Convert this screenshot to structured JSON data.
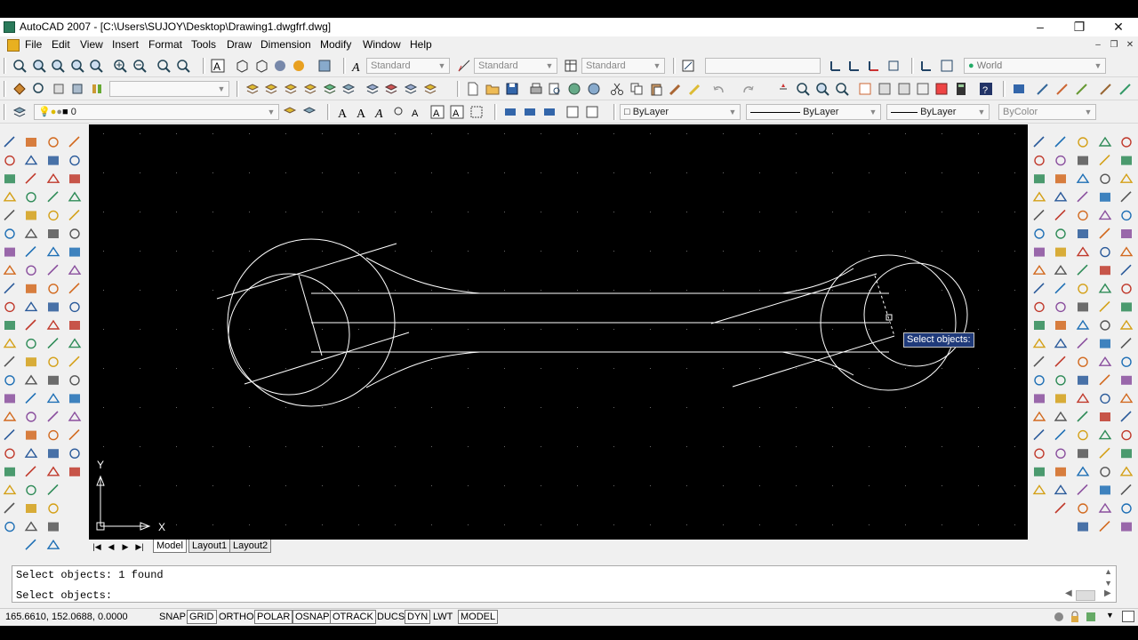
{
  "window": {
    "title": "AutoCAD 2007 - [C:\\Users\\SUJOY\\Desktop\\Drawing1.dwgfrf.dwg]",
    "minimize": "–",
    "restore": "❐",
    "close": "✕"
  },
  "menu": {
    "items": [
      "File",
      "Edit",
      "View",
      "Insert",
      "Format",
      "Tools",
      "Draw",
      "Dimension",
      "Modify",
      "Window",
      "Help"
    ]
  },
  "toolbar1": {
    "text_style": "Standard",
    "dim_style": "Standard",
    "table_style": "Standard",
    "viewport_field": "",
    "ucs": "World"
  },
  "toolbar2": {
    "workspace_field": ""
  },
  "toolbar3": {
    "layer_name": "0",
    "color": "ByLayer",
    "linetype": "ByLayer",
    "lineweight": "ByLayer",
    "plotstyle": "ByColor"
  },
  "canvas": {
    "tooltip": "Select objects:",
    "ucs_x": "X",
    "ucs_y": "Y"
  },
  "tabs": {
    "items": [
      "Model",
      "Layout1",
      "Layout2"
    ],
    "active": "Model"
  },
  "command": {
    "line1": "Select objects: 1 found",
    "line2": "Select objects:"
  },
  "status": {
    "coordinates": "165.6610, 152.0688, 0.0000",
    "buttons": [
      "SNAP",
      "GRID",
      "ORTHO",
      "POLAR",
      "OSNAP",
      "OTRACK",
      "DUCS",
      "DYN",
      "LWT",
      "MODEL"
    ],
    "active_buttons": [
      "GRID",
      "POLAR",
      "OSNAP",
      "OTRACK",
      "DYN",
      "MODEL"
    ]
  },
  "colors": {
    "canvas_bg": "#000000",
    "drawing_stroke": "#ffffff",
    "tooltip_bg": "#1f3a7a",
    "chrome_bg": "#f0f0f0"
  }
}
